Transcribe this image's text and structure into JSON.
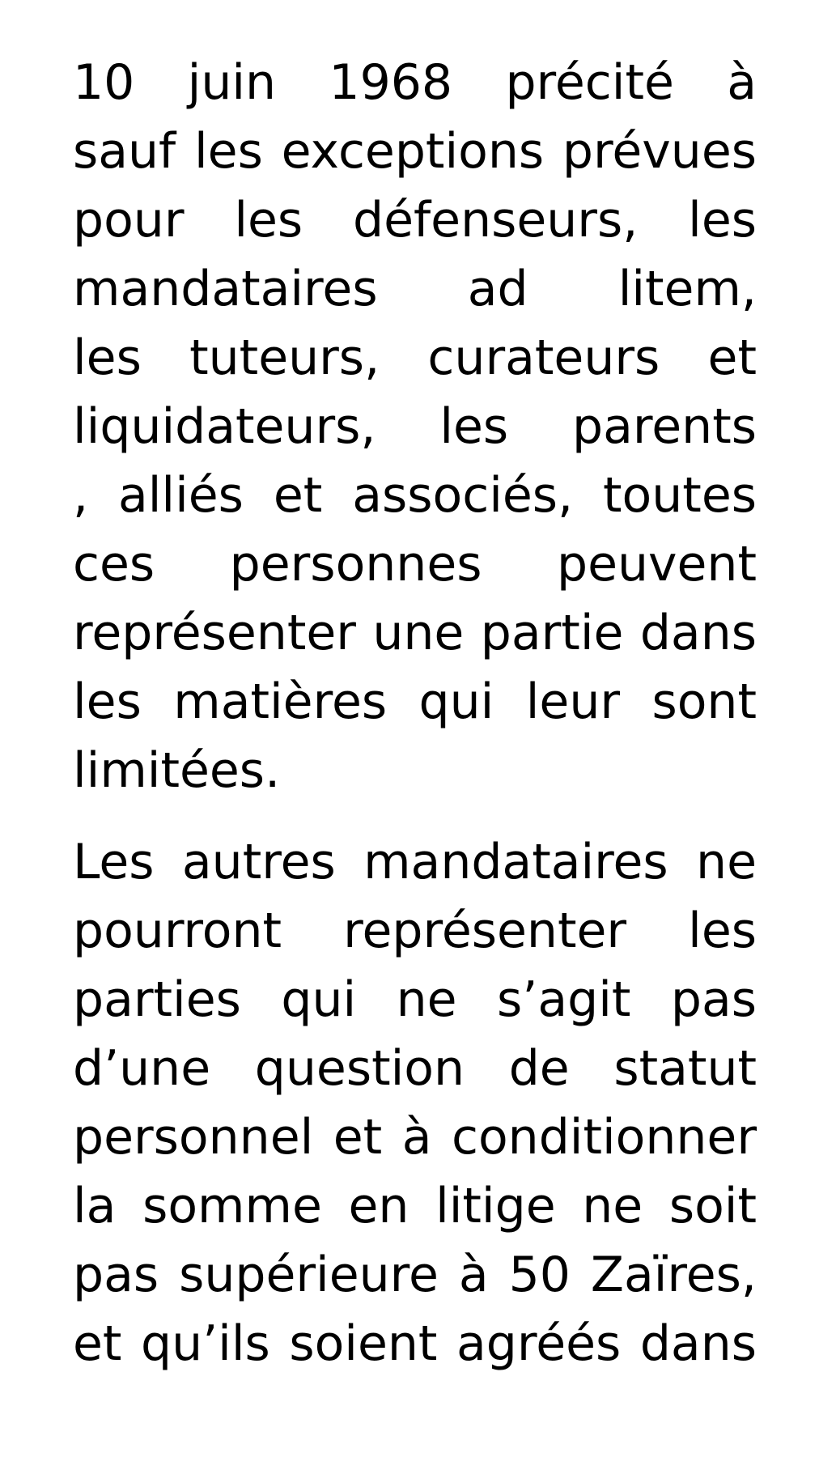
{
  "document": {
    "paragraphs": [
      {
        "lines": [
          "10 juin 1968 précité à",
          "sauf les exceptions prévues",
          "pour  les défenseurs, les",
          "mandataires ad litem,",
          "les tuteurs, curateurs et",
          "liquidateurs, les parents",
          ", alliés et associés, toutes",
          "ces personnes peuvent",
          "représenter une partie dans",
          "les matières qui leur sont",
          "limitées."
        ]
      },
      {
        "lines": [
          "Les autres mandataires ne",
          "pourront représenter les",
          "parties qui ne s’agit pas",
          "d’une question de statut",
          "personnel et à conditionner",
          "la somme  en litige ne soit",
          "pas supérieure à 50 Zaïres,",
          "et qu’ils soient agréés dans"
        ]
      }
    ]
  }
}
